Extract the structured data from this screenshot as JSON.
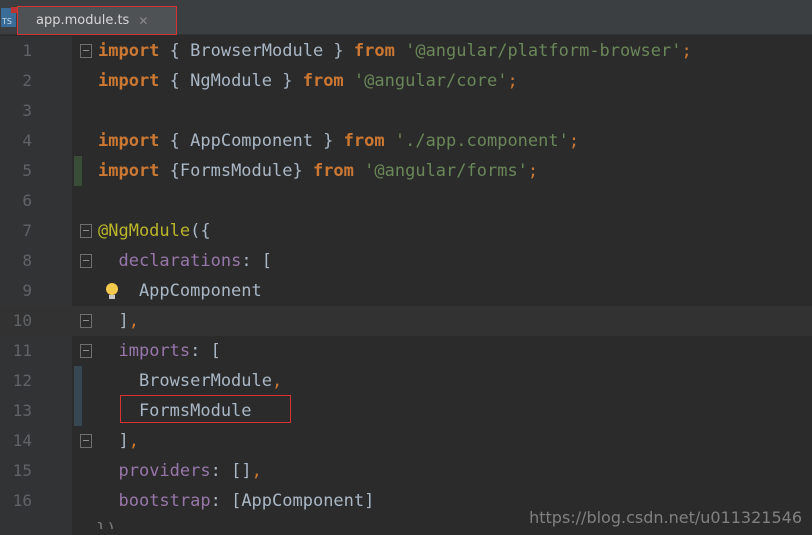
{
  "tab": {
    "title": "app.module.ts",
    "close": "✕",
    "file_label": "TS",
    "icon": "typescript-file-icon"
  },
  "lines": [
    {
      "n": "1",
      "tokens": [
        [
          "kw",
          "import"
        ],
        [
          "plain",
          " { BrowserModule } "
        ],
        [
          "kw",
          "from"
        ],
        [
          "plain",
          " "
        ],
        [
          "str",
          "'@angular/platform-browser'"
        ],
        [
          "punc",
          ";"
        ]
      ]
    },
    {
      "n": "2",
      "tokens": [
        [
          "kw",
          "import"
        ],
        [
          "plain",
          " { NgModule } "
        ],
        [
          "kw",
          "from"
        ],
        [
          "plain",
          " "
        ],
        [
          "str",
          "'@angular/core'"
        ],
        [
          "punc",
          ";"
        ]
      ]
    },
    {
      "n": "3",
      "tokens": []
    },
    {
      "n": "4",
      "tokens": [
        [
          "kw",
          "import"
        ],
        [
          "plain",
          " { AppComponent } "
        ],
        [
          "kw",
          "from"
        ],
        [
          "plain",
          " "
        ],
        [
          "str",
          "'./app.component'"
        ],
        [
          "punc",
          ";"
        ]
      ]
    },
    {
      "n": "5",
      "tokens": [
        [
          "kw",
          "import"
        ],
        [
          "plain",
          " {FormsModule} "
        ],
        [
          "kw",
          "from"
        ],
        [
          "plain",
          " "
        ],
        [
          "str",
          "'@angular/forms'"
        ],
        [
          "punc",
          ";"
        ]
      ]
    },
    {
      "n": "6",
      "tokens": []
    },
    {
      "n": "7",
      "tokens": [
        [
          "anno",
          "@NgModule"
        ],
        [
          "plain",
          "({"
        ]
      ]
    },
    {
      "n": "8",
      "tokens": [
        [
          "plain",
          "  "
        ],
        [
          "prop",
          "declarations"
        ],
        [
          "plain",
          ": ["
        ]
      ]
    },
    {
      "n": "9",
      "tokens": [
        [
          "plain",
          "    AppComponent"
        ]
      ]
    },
    {
      "n": "10",
      "tokens": [
        [
          "plain",
          "  ]"
        ],
        [
          "punc",
          ","
        ]
      ]
    },
    {
      "n": "11",
      "tokens": [
        [
          "plain",
          "  "
        ],
        [
          "prop",
          "imports"
        ],
        [
          "plain",
          ": ["
        ]
      ]
    },
    {
      "n": "12",
      "tokens": [
        [
          "plain",
          "    BrowserModule"
        ],
        [
          "punc",
          ","
        ]
      ]
    },
    {
      "n": "13",
      "tokens": [
        [
          "plain",
          "    FormsModule"
        ]
      ]
    },
    {
      "n": "14",
      "tokens": [
        [
          "plain",
          "  ]"
        ],
        [
          "punc",
          ","
        ]
      ]
    },
    {
      "n": "15",
      "tokens": [
        [
          "plain",
          "  "
        ],
        [
          "prop",
          "providers"
        ],
        [
          "plain",
          ": []"
        ],
        [
          "punc",
          ","
        ]
      ]
    },
    {
      "n": "16",
      "tokens": [
        [
          "plain",
          "  "
        ],
        [
          "prop",
          "bootstrap"
        ],
        [
          "plain",
          ": [AppComponent]"
        ]
      ]
    }
  ],
  "current_line": 10,
  "partial_line": "})",
  "watermark": "https://blog.csdn.net/u011321546",
  "colors": {
    "keyword": "#cc7832",
    "string": "#6a8759",
    "property": "#9876aa",
    "annotation": "#bbb529",
    "text": "#a9b7c6",
    "highlight": "#d83333"
  }
}
